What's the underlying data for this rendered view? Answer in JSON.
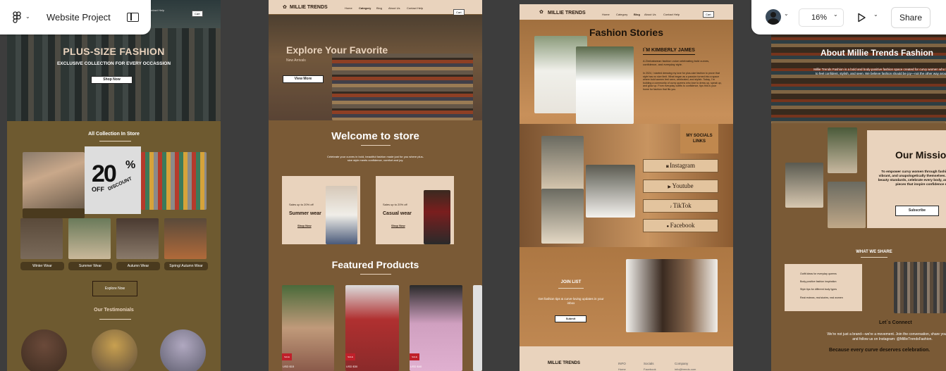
{
  "toolbar": {
    "project_title": "Website Project",
    "zoom": "16%",
    "share_label": "Share"
  },
  "colors": {
    "canvas": "#3d3d3d",
    "brand_beige": "#e9d3bd",
    "brand_brown": "#7a5a36",
    "olive": "#6e5a30"
  },
  "frame1": {
    "nav_text": "Contact Help",
    "cart": "Cart",
    "hero_title": "PLUS-SIZE FASHION",
    "hero_sub": "EXCLUSIVE COLLECTION FOR EVERY OCCASSION",
    "shop_now": "Shop Now",
    "collection_title": "All Collection In Store",
    "discount_big": "20",
    "discount_pct": "%",
    "discount_off": "OFF",
    "discount_word": "DISCOUNT",
    "categories": [
      "Winter Wear",
      "Summer Wear",
      "Autumn Wear",
      "Spring/ Autumn Wear"
    ],
    "explore": "Explore Now",
    "testimonials": "Our Testimonials"
  },
  "frame2": {
    "brand": "MILLIE TRENDS",
    "nav": [
      "Home",
      "Category",
      "Blog",
      "About Us",
      "Contact Help"
    ],
    "cart": "Cart",
    "hero_title": "Explore  Your Favorite",
    "hero_sub": "New Arrivals",
    "view_more": "View More",
    "welcome": "Welcome to store",
    "welcome_body": "Celebrate your curves in bold, beautiful fashion made just for you where plus-size style meets confidence, comfort and joy.",
    "promo1_small": "Sales up to 20% off",
    "promo1_title": "Summer wear",
    "promo1_link": "Shop Now",
    "promo2_small": "Sales up to 20% off",
    "promo2_title": "Casual wear",
    "promo2_link": "Shop Now",
    "featured": "Featured Products",
    "prices": [
      "USD $15",
      "USD $30",
      "USD $40"
    ],
    "sale": "SALE"
  },
  "frame3": {
    "brand": "MILLIE TRENDS",
    "nav": [
      "Home",
      "Category",
      "Blog",
      "About Us",
      "Contact Help"
    ],
    "cart": "Cart",
    "title": "Fashion Stories",
    "author": "I`M KIMBERLY JAMES",
    "bio1": "A Zimbabwean fashion voice celebrating bold curves, confidence, and everyday style.",
    "bio2": "In 2024, I started dressing my love for plus-size fashion to prove that style has no size limit. What began as a passion turned into a space where bold women feel seen, celebrated, and stylish. Today, I`m building a community of curvy queens who love to dress up, speak up, and glow up. From everyday outfits to confidence, tips this is your home for fashion that fits you.",
    "socials_title": "MY SOCIALS LINKS",
    "socials": [
      "Instagram",
      "Youtube",
      "TikTok",
      "Facebook"
    ],
    "join": "JOIN LIST",
    "join_body": "Get fashion tips & curve-loving updates in your inbox",
    "submit": "Submit",
    "footer_brand": "MILLIE TRENDS",
    "footer_cols": [
      "INFO",
      "Socials",
      "Company"
    ],
    "footer_items": [
      "Home",
      "Facebook",
      "info@trends.com"
    ]
  },
  "frame4": {
    "about": "About Millie Trends Fashion",
    "about_body": "Millie Trends Fashion is a bold and body-positive fashion space created for curvy women who love to feel confident, stylish, and seen. We believe fashion should be joy—not the other way around",
    "mission": "Our Mission",
    "mission_body": "To empower curvy women through fashion that is modern, vibrant, and unapologetically themselves. We're here to break beauty standards, celebrate every body, and uplift women with pieces that inspire confidence every day.",
    "subscribe": "Subscribe",
    "share_title": "WHAT WE SHARE",
    "share_items": [
      "Outfit ideas for everyday queens",
      "Body-positive fashion inspiration",
      "Style tips for different body types",
      "Real reviews, real stories, real women"
    ],
    "connect": "Let`s Connect",
    "connect_body": "We're not just a brand—we're a movement. Join the conversation, share your looks, and follow us on Instagram: @MillieTrendsFashion.",
    "tagline": "Because every curve deserves celebration."
  }
}
